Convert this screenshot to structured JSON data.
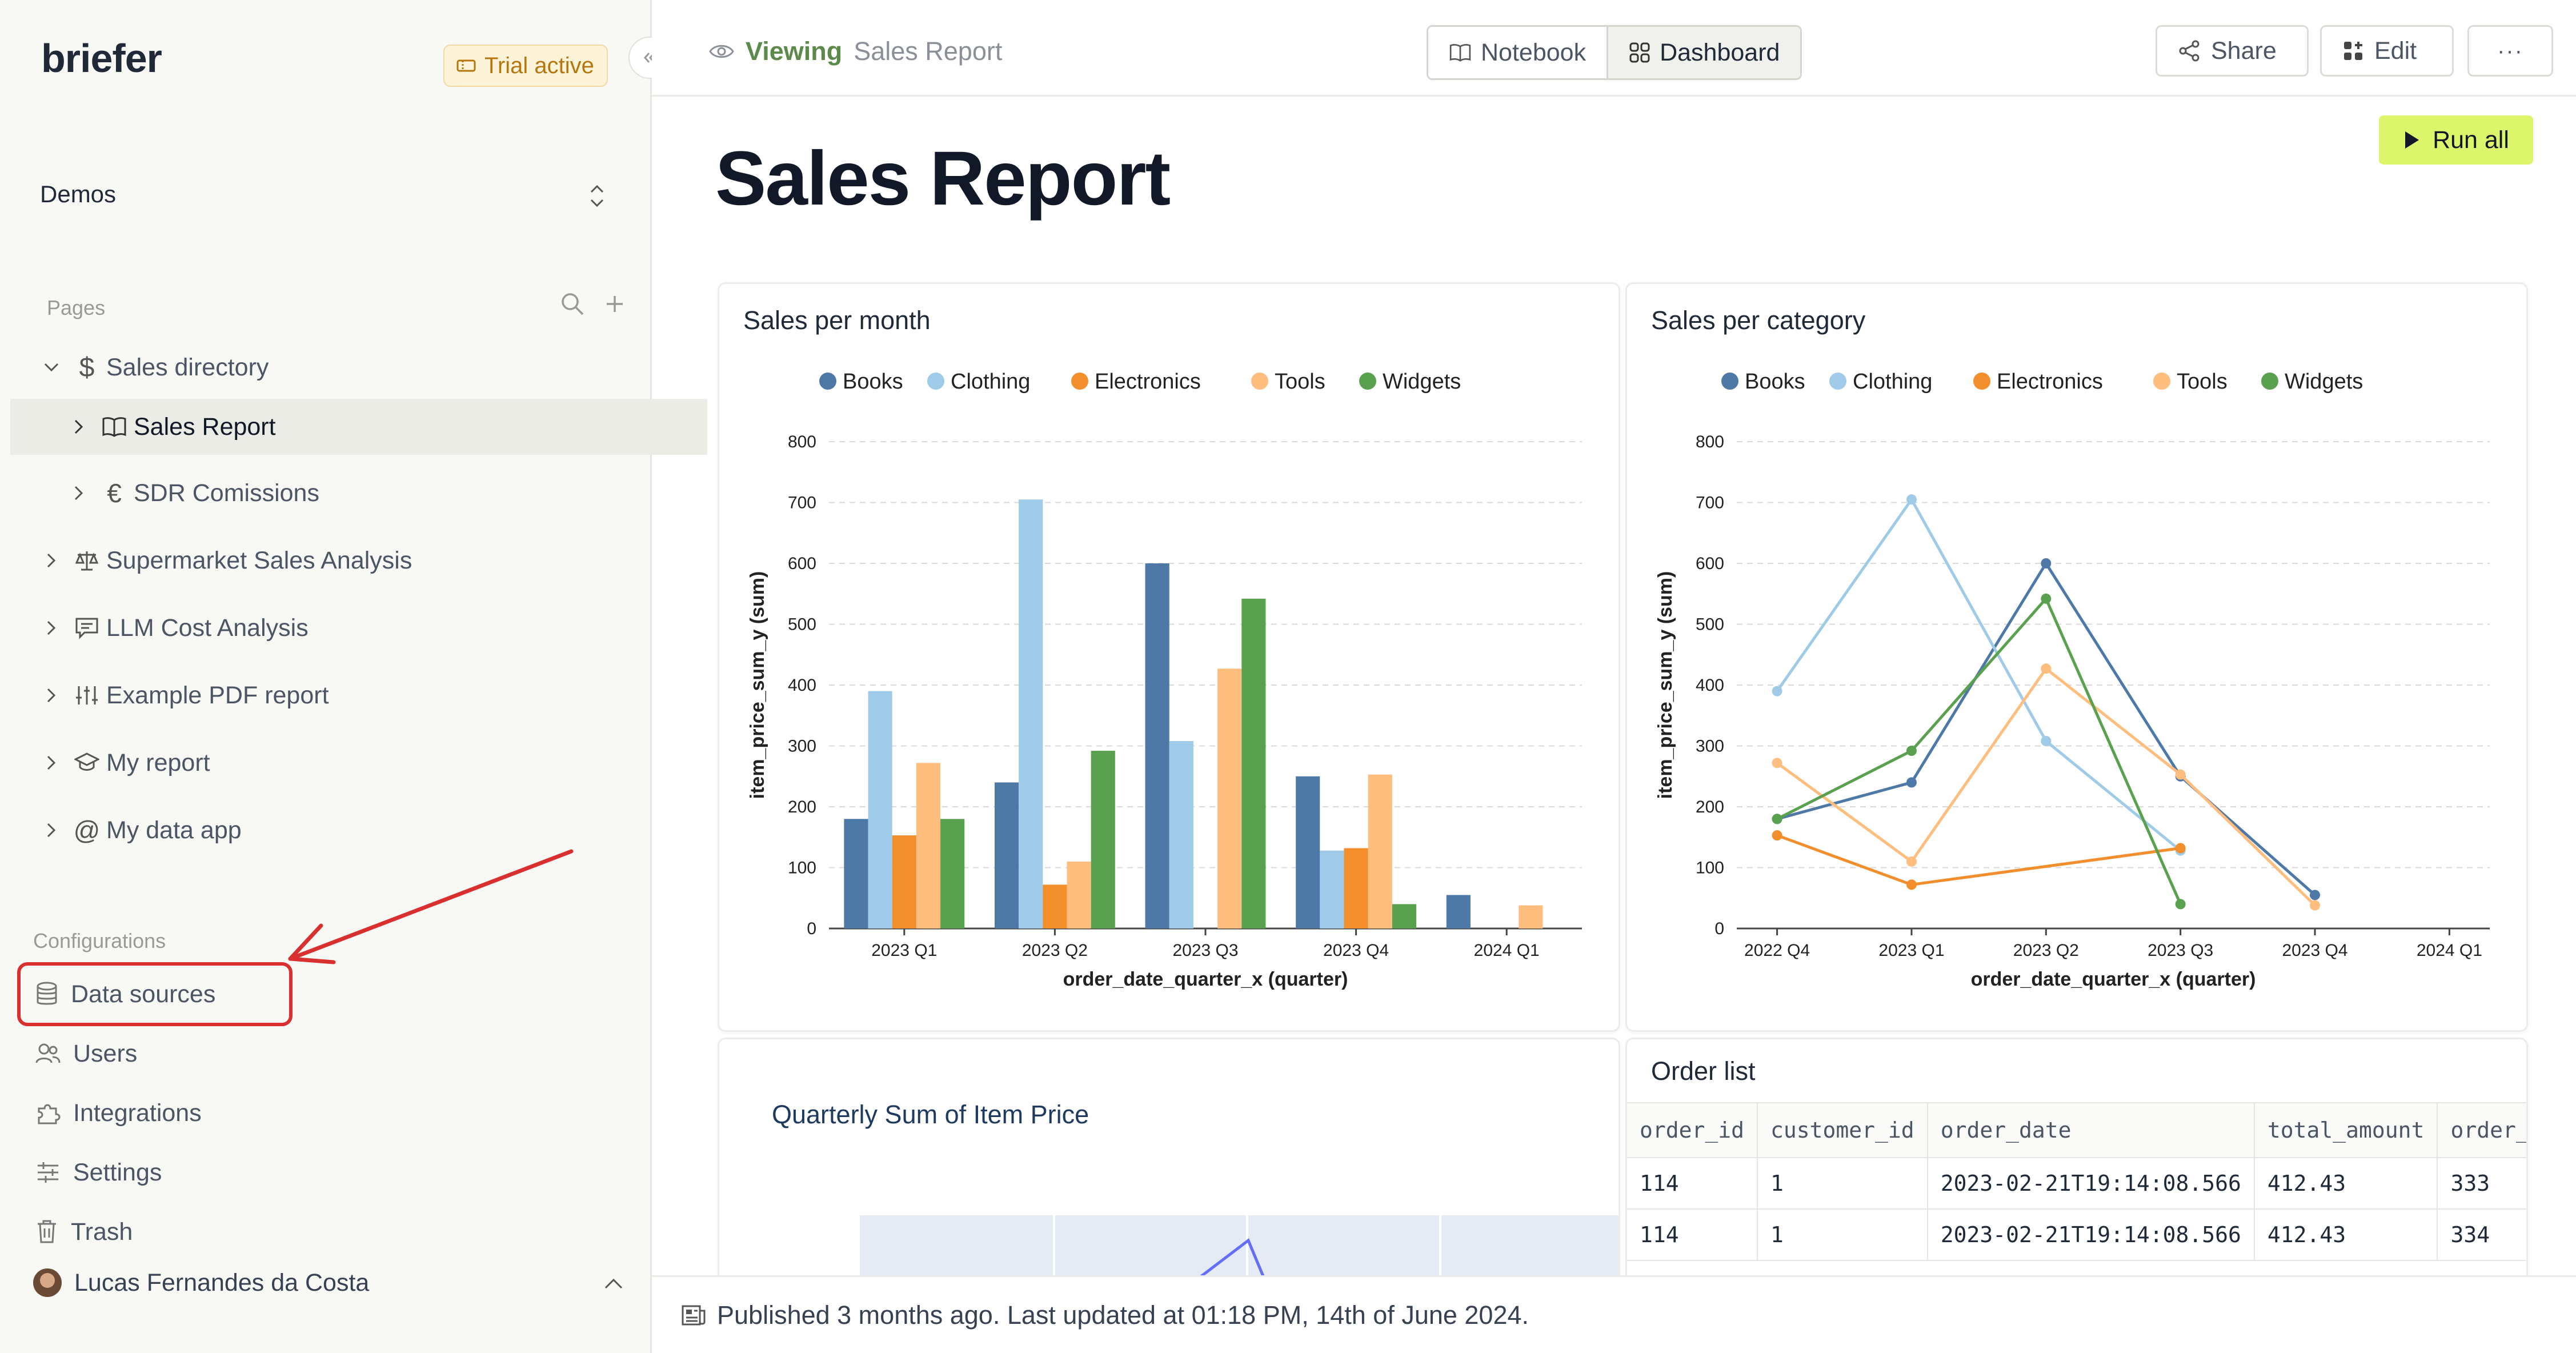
{
  "app": {
    "logo": "briefer",
    "trial_badge": "Trial active"
  },
  "sidebar": {
    "workspace": "Demos",
    "pages_label": "Pages",
    "pages": [
      {
        "label": "Sales directory",
        "icon": "dollar-icon"
      },
      {
        "label": "Sales Report",
        "icon": "book-icon",
        "active": true
      },
      {
        "label": "SDR Comissions",
        "icon": "euro-icon"
      },
      {
        "label": "Supermarket Sales Analysis",
        "icon": "scale-icon"
      },
      {
        "label": "LLM Cost Analysis",
        "icon": "chat-icon"
      },
      {
        "label": "Example PDF report",
        "icon": "sliders-icon"
      },
      {
        "label": "My report",
        "icon": "graduation-cap-icon"
      },
      {
        "label": "My data app",
        "icon": "at-icon"
      }
    ],
    "configurations_label": "Configurations",
    "configurations": [
      {
        "label": "Data sources",
        "icon": "database-icon"
      },
      {
        "label": "Users",
        "icon": "users-icon"
      },
      {
        "label": "Integrations",
        "icon": "puzzle-icon"
      },
      {
        "label": "Settings",
        "icon": "settings-sliders-icon"
      },
      {
        "label": "Trash",
        "icon": "trash-icon"
      }
    ],
    "user": "Lucas Fernandes da Costa"
  },
  "topbar": {
    "viewing_label": "Viewing",
    "viewing_page": "Sales Report",
    "mode_notebook": "Notebook",
    "mode_dashboard": "Dashboard",
    "share": "Share",
    "edit": "Edit",
    "more": "···"
  },
  "main": {
    "run_all": "Run all",
    "title": "Sales Report",
    "quarterly_title": "Quarterly Sum of Item Price",
    "order_list": {
      "title": "Order list",
      "columns": [
        "order_id",
        "customer_id",
        "order_date",
        "total_amount",
        "order_"
      ],
      "rows": [
        [
          "114",
          "1",
          "2023-02-21T19:14:08.566",
          "412.43",
          "333"
        ],
        [
          "114",
          "1",
          "2023-02-21T19:14:08.566",
          "412.43",
          "334"
        ]
      ]
    }
  },
  "footer": {
    "text": "Published 3 months ago. Last updated at 01:18 PM, 14th of June 2024."
  },
  "colors": {
    "Books": "#4e79a7",
    "Clothing": "#a0cbe8",
    "Electronics": "#f28e2b",
    "Tools": "#ffbe7d",
    "Widgets": "#59a14f",
    "accent": "#dcf56b",
    "callout": "#d9302f"
  },
  "chart_data": [
    {
      "type": "bar",
      "title": "Sales per month",
      "categories": [
        "2023 Q1",
        "2023 Q2",
        "2023 Q3",
        "2023 Q4",
        "2024 Q1"
      ],
      "series": [
        {
          "name": "Books",
          "values": [
            180,
            240,
            600,
            250,
            55
          ]
        },
        {
          "name": "Clothing",
          "values": [
            390,
            705,
            308,
            128,
            null
          ]
        },
        {
          "name": "Electronics",
          "values": [
            153,
            72,
            null,
            132,
            null
          ]
        },
        {
          "name": "Tools",
          "values": [
            272,
            110,
            427,
            253,
            38
          ]
        },
        {
          "name": "Widgets",
          "values": [
            180,
            292,
            542,
            40,
            null
          ]
        }
      ],
      "xlabel": "order_date_quarter_x (quarter)",
      "ylabel": "item_price_sum_y (sum)",
      "ylim": [
        0,
        800
      ],
      "yticks": [
        0,
        100,
        200,
        300,
        400,
        500,
        600,
        700,
        800
      ],
      "legend": "top"
    },
    {
      "type": "line",
      "title": "Sales per category",
      "categories": [
        "2022 Q4",
        "2023 Q1",
        "2023 Q2",
        "2023 Q3",
        "2023 Q4",
        "2024 Q1"
      ],
      "series": [
        {
          "name": "Books",
          "values": [
            180,
            240,
            600,
            250,
            55,
            null
          ]
        },
        {
          "name": "Clothing",
          "values": [
            390,
            705,
            308,
            128,
            null,
            null
          ]
        },
        {
          "name": "Electronics",
          "values": [
            153,
            72,
            null,
            132,
            null,
            null
          ]
        },
        {
          "name": "Tools",
          "values": [
            272,
            110,
            427,
            253,
            38,
            null
          ]
        },
        {
          "name": "Widgets",
          "values": [
            180,
            292,
            542,
            40,
            null,
            null
          ]
        }
      ],
      "xlabel": "order_date_quarter_x (quarter)",
      "ylabel": "item_price_sum_y (sum)",
      "ylim": [
        0,
        800
      ],
      "yticks": [
        0,
        100,
        200,
        300,
        400,
        500,
        600,
        700,
        800
      ],
      "legend": "top"
    }
  ]
}
